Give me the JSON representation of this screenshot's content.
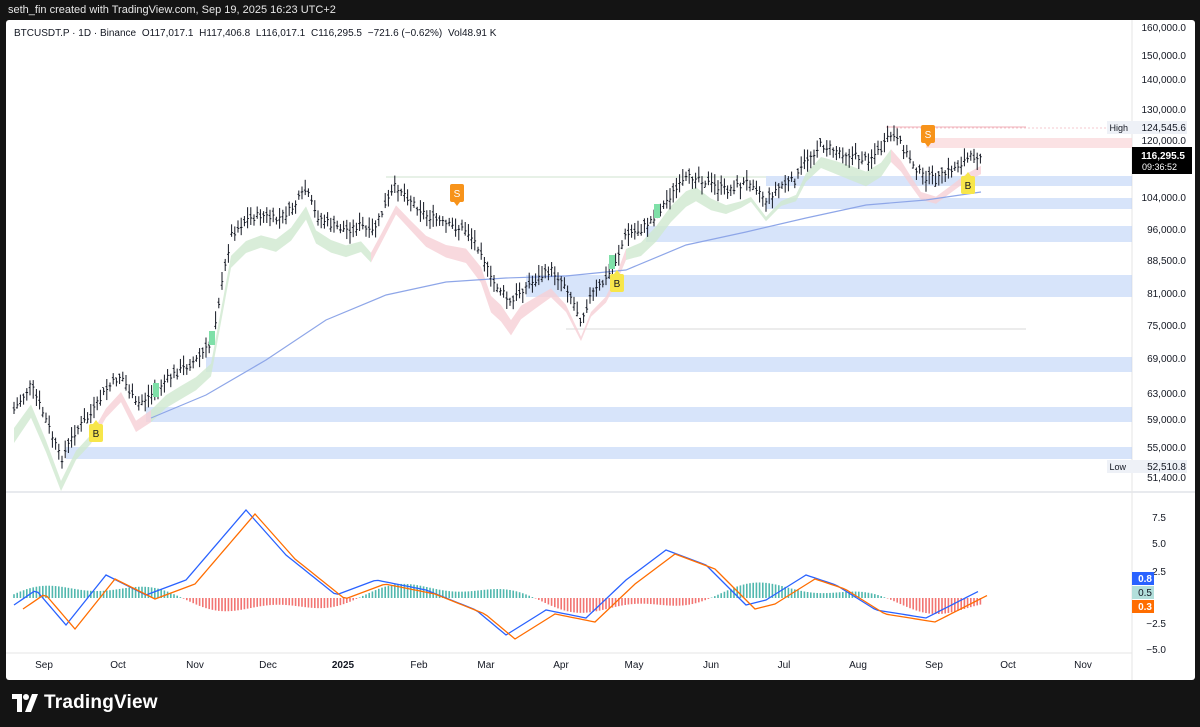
{
  "header": {
    "text": "seth_fin created with TradingView.com, Sep 19, 2025 16:23 UTC+2"
  },
  "symbol": {
    "name": "BTCUSDT.P · 1D · Binance",
    "open": "O117,017.1",
    "high": "H117,406.8",
    "low": "L116,017.1",
    "close": "C116,295.5",
    "change": "−721.6 (−0.62%)",
    "volume": "Vol48.91 K"
  },
  "price_axis": {
    "ticks": [
      "160,000.0",
      "150,000.0",
      "140,000.0",
      "130,000.0",
      "120,000.0",
      "104,000.0",
      "96,000.0",
      "88,500.0",
      "81,000.0",
      "75,000.0",
      "69,000.0",
      "63,000.0",
      "59,000.0",
      "55,000.0",
      "51,400.0"
    ],
    "high_label": "High",
    "high_value": "124,545.6",
    "current_price": "116,295.5",
    "countdown": "09:36:52",
    "low_label": "Low",
    "low_value": "52,510.8"
  },
  "osc_axis": {
    "ticks": [
      "7.5",
      "5.0",
      "2.5",
      "−2.5",
      "−5.0"
    ],
    "blue_value": "0.8",
    "teal_value": "0.5",
    "orange_value": "0.3"
  },
  "time_axis": [
    "Sep",
    "Oct",
    "Nov",
    "Dec",
    "2025",
    "Feb",
    "Mar",
    "Apr",
    "May",
    "Jun",
    "Jul",
    "Aug",
    "Sep",
    "Oct",
    "Nov"
  ],
  "signals": [
    {
      "label": "B",
      "type": "buy"
    },
    {
      "label": "S",
      "type": "sell"
    },
    {
      "label": "B",
      "type": "buy"
    },
    {
      "label": "S",
      "type": "sell"
    },
    {
      "label": "B",
      "type": "buy"
    }
  ],
  "colors": {
    "up": "#131722",
    "demand_zone": "#b7cdf5",
    "ema_bull_fill": "#cfe8cf",
    "ema_bear_fill": "#f6cfd6",
    "sma_line": "#8ea6e8",
    "macd_line": "#2962ff",
    "signal_line": "#ff6d00",
    "hist_pos": "#26a69a",
    "hist_neg": "#ef5350",
    "buy_badge": "#f7e64a",
    "sell_badge": "#f7931a",
    "price_tag": "#000000"
  },
  "footer": {
    "brand": "TradingView"
  }
}
